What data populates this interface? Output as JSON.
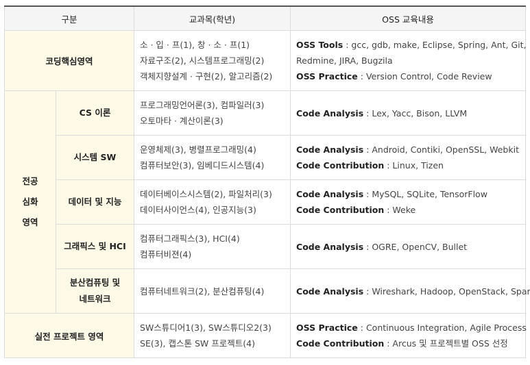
{
  "header": {
    "col1": "구분",
    "col2": "교과목(학년)",
    "col3": "OSS 교육내용"
  },
  "rows": {
    "core": {
      "area": "코딩핵심영역",
      "courses": [
        "소 · 입 · 프(1), 창 · 소 · 프(1)",
        "자료구조(2), 시스템프로그래밍(2)",
        "객체지향설계 · 구현(2), 알고리즘(2)"
      ],
      "oss": [
        {
          "label": "OSS Tools",
          "text": "gcc, gdb, make, Eclipse, Spring, Ant, Git,"
        },
        {
          "label": "",
          "text": "Redmine, JIRA, Bugzila"
        },
        {
          "label": "OSS Practice",
          "text": "Version Control, Code Review"
        }
      ]
    },
    "advanced": {
      "area": [
        "전공",
        "심화",
        "영역"
      ],
      "subs": [
        {
          "name": [
            "CS 이론"
          ],
          "courses": [
            "프로그래밍언어론(3), 컴파일러(3)",
            "오토마타 · 계산이론(3)"
          ],
          "oss": [
            {
              "label": "Code Analysis",
              "text": "Lex, Yacc, Bison, LLVM"
            }
          ]
        },
        {
          "name": [
            "시스템 SW"
          ],
          "courses": [
            "운영체제(3), 병렬프로그래밍(4)",
            "컴퓨터보안(3), 임베디드시스템(4)"
          ],
          "oss": [
            {
              "label": "Code Analysis",
              "text": "Android, Contiki, OpenSSL, Webkit"
            },
            {
              "label": "Code Contribution",
              "text": "Linux, Tizen"
            }
          ]
        },
        {
          "name": [
            "데이터 및 지능"
          ],
          "courses": [
            "데이터베이스시스템(2), 파일처리(3)",
            "데이터사이언스(4), 인공지능(3)"
          ],
          "oss": [
            {
              "label": "Code Analysis",
              "text": "MySQL, SQLite, TensorFlow"
            },
            {
              "label": "Code Contribution",
              "text": "Weke"
            }
          ]
        },
        {
          "name": [
            "그래픽스 및 HCI"
          ],
          "courses": [
            "컴퓨터그래픽스(3), HCI(4)",
            "컴퓨터비젼(4)"
          ],
          "oss": [
            {
              "label": "Code Analysis",
              "text": "OGRE, OpenCV, Bullet"
            }
          ]
        },
        {
          "name": [
            "분산컴퓨팅 및",
            "네트워크"
          ],
          "courses": [
            "컴퓨터네트워크(2), 분산컴퓨팅(4)"
          ],
          "oss": [
            {
              "label": "Code Analysis",
              "text": "Wireshark, Hadoop, OpenStack, Spark"
            }
          ]
        }
      ]
    },
    "project": {
      "area": "실전 프로젝트 영역",
      "courses": [
        "SW스튜디어1(3), SW스튜디오2(3)",
        "SE(3), 캡스톤 SW 프로젝트(4)"
      ],
      "oss": [
        {
          "label": "OSS Practice",
          "text": "Continuous Integration, Agile Process"
        },
        {
          "label": "Code Contribution",
          "text": "Arcus 및 프로젝트별 OSS 선정"
        }
      ]
    }
  }
}
